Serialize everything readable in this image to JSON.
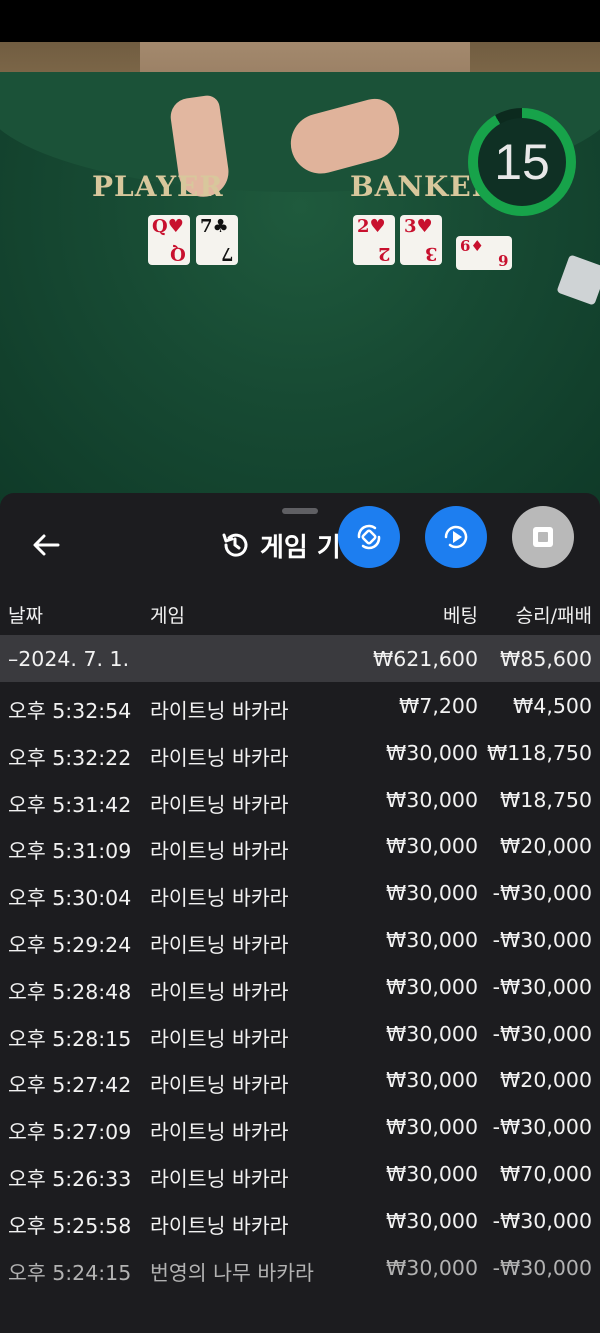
{
  "video": {
    "timer": "15",
    "player_label": "PLAYER",
    "banker_label": "BANKER",
    "player_cards": [
      {
        "rank": "Q",
        "suit": "♥",
        "color": "red"
      },
      {
        "rank": "7",
        "suit": "♣",
        "color": "black"
      }
    ],
    "banker_cards": [
      {
        "rank": "2",
        "suit": "♥",
        "color": "red"
      },
      {
        "rank": "3",
        "suit": "♥",
        "color": "red"
      },
      {
        "rank": "6",
        "suit": "♦",
        "color": "red"
      }
    ]
  },
  "sheet": {
    "title": "게임 기",
    "fabs": [
      {
        "name": "rotate-button",
        "icon": "rotate-icon"
      },
      {
        "name": "replay-button",
        "icon": "play-circle-icon"
      },
      {
        "name": "stop-button",
        "icon": "stop-icon"
      }
    ],
    "columns": {
      "date": "날짜",
      "game": "게임",
      "bet": "베팅",
      "win": "승리/패배"
    },
    "summary": {
      "date": "–2024. 7. 1.",
      "bet": "₩621,600",
      "win": "₩85,600"
    },
    "rows": [
      {
        "time": "오후 5:32:54",
        "game": "라이트닝 바카라",
        "bet": "₩7,200",
        "win": "₩4,500"
      },
      {
        "time": "오후 5:32:22",
        "game": "라이트닝 바카라",
        "bet": "₩30,000",
        "win": "₩118,750"
      },
      {
        "time": "오후 5:31:42",
        "game": "라이트닝 바카라",
        "bet": "₩30,000",
        "win": "₩18,750"
      },
      {
        "time": "오후 5:31:09",
        "game": "라이트닝 바카라",
        "bet": "₩30,000",
        "win": "₩20,000"
      },
      {
        "time": "오후 5:30:04",
        "game": "라이트닝 바카라",
        "bet": "₩30,000",
        "win": "-₩30,000"
      },
      {
        "time": "오후 5:29:24",
        "game": "라이트닝 바카라",
        "bet": "₩30,000",
        "win": "-₩30,000"
      },
      {
        "time": "오후 5:28:48",
        "game": "라이트닝 바카라",
        "bet": "₩30,000",
        "win": "-₩30,000"
      },
      {
        "time": "오후 5:28:15",
        "game": "라이트닝 바카라",
        "bet": "₩30,000",
        "win": "-₩30,000"
      },
      {
        "time": "오후 5:27:42",
        "game": "라이트닝 바카라",
        "bet": "₩30,000",
        "win": "₩20,000"
      },
      {
        "time": "오후 5:27:09",
        "game": "라이트닝 바카라",
        "bet": "₩30,000",
        "win": "-₩30,000"
      },
      {
        "time": "오후 5:26:33",
        "game": "라이트닝 바카라",
        "bet": "₩30,000",
        "win": "₩70,000"
      },
      {
        "time": "오후 5:25:58",
        "game": "라이트닝 바카라",
        "bet": "₩30,000",
        "win": "-₩30,000"
      },
      {
        "time": "오후 5:24:15",
        "game": "번영의 나무 바카라",
        "bet": "₩30,000",
        "win": "-₩30,000"
      }
    ]
  }
}
